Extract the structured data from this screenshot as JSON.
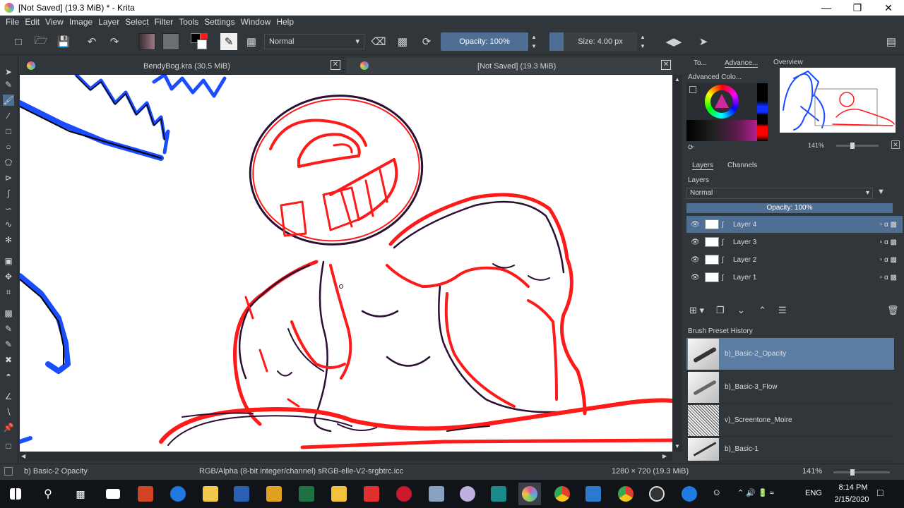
{
  "window": {
    "title": "[Not Saved]  (19.3 MiB) * - Krita",
    "minimize_icon": "minimize-icon",
    "restore_icon": "restore-icon",
    "close_icon": "close-icon"
  },
  "menu": [
    "File",
    "Edit",
    "View",
    "Image",
    "Layer",
    "Select",
    "Filter",
    "Tools",
    "Settings",
    "Window",
    "Help"
  ],
  "toolbar": {
    "blend_mode": "Normal",
    "opacity_label": "Opacity:  100%",
    "size_label": "Size:  4.00 px",
    "accent": "#4e6e94"
  },
  "doc_tabs": [
    {
      "label": "BendyBog.kra (30.5 MiB)"
    },
    {
      "label": "[Not Saved]  (19.3 MiB)"
    }
  ],
  "dock": {
    "top_tabs": [
      "To...",
      "Advance..."
    ],
    "advanced_color": "Advanced Colo...",
    "overview_title": "Overview",
    "overview_zoom": "141%",
    "layer_tabs": [
      "Layers",
      "Channels"
    ],
    "layers_title": "Layers",
    "layers_blend": "Normal",
    "layers_opacity": "Opacity:  100%",
    "layers": [
      {
        "name": "Layer 4",
        "active": true
      },
      {
        "name": "Layer 3",
        "active": false
      },
      {
        "name": "Layer 2",
        "active": false
      },
      {
        "name": "Layer 1",
        "active": false
      }
    ],
    "brush_history_title": "Brush Preset History",
    "brushes": [
      {
        "name": "b)_Basic-2_Opacity",
        "active": true
      },
      {
        "name": "b)_Basic-3_Flow",
        "active": false
      },
      {
        "name": "v)_Screentone_Moire",
        "active": false
      },
      {
        "name": "b)_Basic-1",
        "active": false
      }
    ]
  },
  "status": {
    "brush": "b) Basic-2 Opacity",
    "color_space": "RGB/Alpha (8-bit integer/channel)  sRGB-elle-V2-srgbtrc.icc",
    "dimensions": "1280 × 720 (19.3 MiB)",
    "zoom": "141%"
  },
  "taskbar": {
    "time": "8:14 PM",
    "date": "2/15/2020",
    "language": "ENG"
  },
  "colors": {
    "sketch_red": "#ff1a1a",
    "sketch_dark": "#2a0f33",
    "sketch_blue": "#1a4dff",
    "panel_bg": "#31363b",
    "highlight": "#4e6e94"
  }
}
